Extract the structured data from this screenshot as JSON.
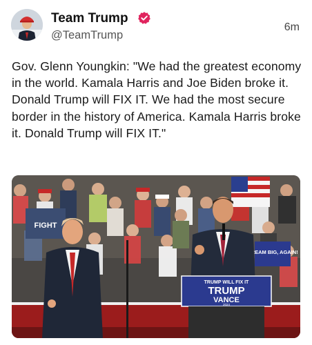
{
  "post": {
    "display_name": "Team Trump",
    "handle": "@TeamTrump",
    "timestamp": "6m",
    "text": "Gov. Glenn Youngkin: \"We had the greatest economy in the world. Kamala Harris and Joe Biden broke it. Donald Trump will FIX IT. We had the most secure border in the history of America. Kamala Harris broke it. Donald Trump will FIX IT.\""
  },
  "media": {
    "podium_sign_top": "TRUMP WILL FIX IT",
    "podium_sign_trump": "TRUMP",
    "podium_sign_vance": "VANCE",
    "podium_sign_year": "2024",
    "crowd_sign_left": "FIGHT",
    "crowd_sign_right": "DREAM BIG, AGAIN!"
  },
  "icons": {
    "verified": "verified-badge-icon"
  },
  "colors": {
    "verified_badge": "#e0245e",
    "podium_blue": "#2b3a8f",
    "stage_red": "#b71c1c"
  }
}
